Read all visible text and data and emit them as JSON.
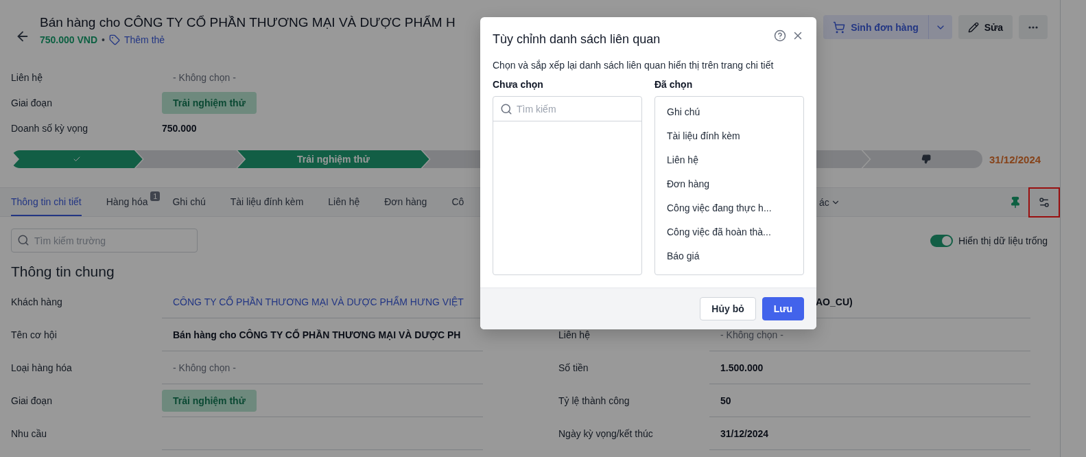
{
  "header": {
    "title": "Bán hàng cho CÔNG TY CỔ PHẦN THƯƠNG MẠI VÀ DƯỢC PHẨM H",
    "amount": "750.000 VND",
    "separator": "•",
    "add_tag": "Thêm thẻ",
    "actions": [
      {
        "kind": "split",
        "label": "Sinh đơn hàng"
      },
      {
        "kind": "edit",
        "label": "Sửa"
      },
      {
        "kind": "more"
      }
    ]
  },
  "summary": [
    {
      "label": "Liên hệ",
      "value": "- Không chọn -",
      "kind": "empty"
    },
    {
      "label": "Giai đoạn",
      "value": "Trải nghiệm thử",
      "kind": "tag"
    },
    {
      "label": "Doanh số kỳ vọng",
      "value": "750.000",
      "kind": "bold"
    }
  ],
  "stages": [
    {
      "kind": "done"
    },
    {
      "kind": "pending"
    },
    {
      "kind": "current",
      "label": "Trải nghiệm thử"
    },
    {
      "kind": "pending"
    },
    {
      "kind": "pending"
    },
    {
      "kind": "lost"
    }
  ],
  "due_date": "31/12/2024",
  "tabs": [
    {
      "label": "Thông tin chi tiết",
      "selected": true
    },
    {
      "label": "Hàng hóa",
      "badge": "1",
      "selected": false
    },
    {
      "label": "Ghi chú",
      "selected": false
    },
    {
      "label": "Tài liệu đính kèm",
      "selected": false
    },
    {
      "label": "Liên hệ",
      "selected": false
    },
    {
      "label": "Đơn hàng",
      "selected": false
    },
    {
      "label": "Cô",
      "selected": false
    }
  ],
  "more_tab": {
    "label": "ác"
  },
  "toolbar": {
    "search": {
      "placeholder": "Tìm kiếm trường"
    },
    "toggle": {
      "label": "Hiển thị dữ liệu trống",
      "on": true
    }
  },
  "section_title": "Thông tin chung",
  "fields_left": [
    {
      "label": "Khách hàng",
      "value": "CÔNG TY CỔ PHẦN THƯƠNG MẠI VÀ DƯỢC PHẨM HƯNG VIỆT",
      "kind": "link"
    },
    {
      "label": "Tên cơ hội",
      "value": "Bán hàng cho CÔNG TY CỔ PHẦN THƯƠNG MẠI VÀ DƯỢC PH",
      "kind": "text"
    },
    {
      "label": "Loại hàng hóa",
      "value": "- Không chọn -",
      "kind": "empty"
    },
    {
      "label": "Giai đoạn",
      "value": "Trải nghiệm thử",
      "kind": "tag"
    },
    {
      "label": "Nhu cầu",
      "kind": "text"
    }
  ],
  "fields_right": [
    {
      "value": "AO_CU)",
      "kind": "covered"
    },
    {
      "label": "Liên hệ",
      "value": "- Không chọn -",
      "kind": "empty"
    },
    {
      "label": "Số tiền",
      "value": "1.500.000",
      "kind": "text"
    },
    {
      "label": "Tỷ lệ thành công",
      "value": "50",
      "kind": "text"
    },
    {
      "label": "Ngày kỳ vọng/kết thúc",
      "value": "31/12/2024",
      "kind": "text"
    }
  ],
  "dialog": {
    "title": "Tùy chỉnh danh sách liên quan",
    "description": "Chọn và sắp xếp lại danh sách liên quan hiển thị trên trang chi tiết",
    "available": {
      "title": "Chưa chọn",
      "search": {
        "placeholder": "Tìm kiếm"
      }
    },
    "chosen": {
      "title": "Đã chọn",
      "items": [
        "Ghi chú",
        "Tài liệu đính kèm",
        "Liên hệ",
        "Đơn hàng",
        "Công việc đang thực h...",
        "Công việc đã hoàn thà...",
        "Báo giá"
      ]
    },
    "buttons": [
      {
        "kind": "secondary",
        "label": "Hủy bỏ"
      },
      {
        "kind": "primary",
        "label": "Lưu"
      }
    ]
  }
}
